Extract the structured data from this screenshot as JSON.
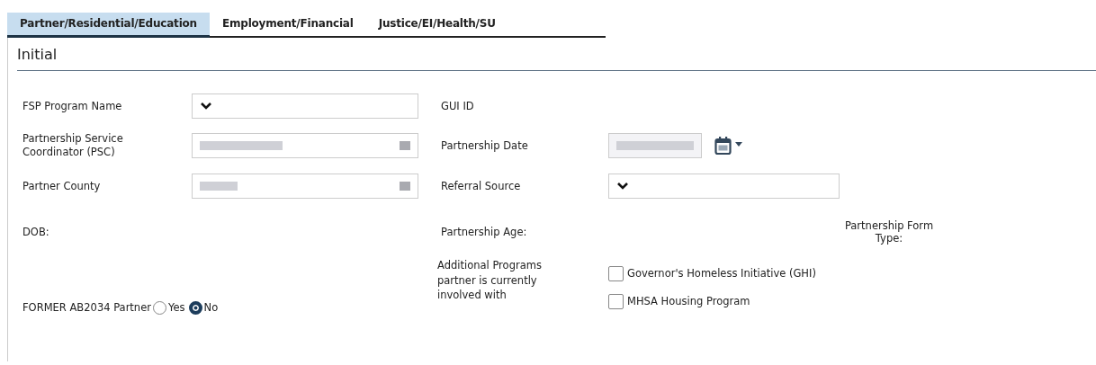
{
  "tabs": [
    {
      "label": "Partner/Residential/Education",
      "selected": true
    },
    {
      "label": "Employment/Financial",
      "selected": false
    },
    {
      "label": "Justice/EI/Health/SU",
      "selected": false
    }
  ],
  "section": {
    "title": "Initial"
  },
  "fields": {
    "fsp_program_name": {
      "label": "FSP Program Name"
    },
    "gui_id": {
      "label": "GUI ID"
    },
    "psc": {
      "label": "Partnership Service Coordinator (PSC)"
    },
    "partnership_date": {
      "label": "Partnership Date"
    },
    "partner_county": {
      "label": "Partner County"
    },
    "referral_source": {
      "label": "Referral Source"
    },
    "dob": {
      "label": "DOB:"
    },
    "partnership_age": {
      "label": "Partnership Age:"
    },
    "partnership_form_type": {
      "label": "Partnership Form Type:"
    },
    "former_ab2034": {
      "label": "FORMER AB2034 Partner",
      "options": [
        {
          "label": "Yes",
          "selected": false
        },
        {
          "label": "No",
          "selected": true
        }
      ]
    },
    "additional_programs": {
      "label": "Additional Programs partner is currently involved with",
      "options": [
        {
          "label": "Governor's Homeless Initiative (GHI)",
          "checked": false
        },
        {
          "label": "MHSA Housing Program",
          "checked": false
        }
      ]
    }
  }
}
